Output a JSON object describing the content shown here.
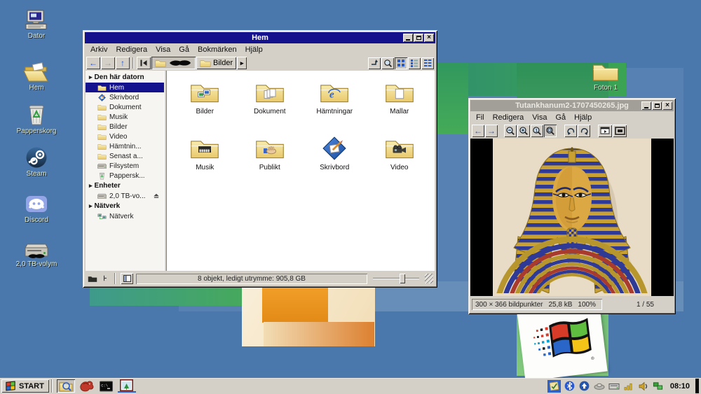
{
  "desktop": {
    "icons": [
      {
        "label": "Dator"
      },
      {
        "label": "Hem"
      },
      {
        "label": "Papperskorg"
      },
      {
        "label": "Steam"
      },
      {
        "label": "Discord"
      },
      {
        "label": "2,0 TB-volym"
      },
      {
        "label": "Foton 1"
      }
    ]
  },
  "file_manager": {
    "title": "Hem",
    "menus": [
      "Arkiv",
      "Redigera",
      "Visa",
      "Gå",
      "Bokmärken",
      "Hjälp"
    ],
    "toolbar": {
      "current_folder": "Bilder"
    },
    "sidebar": {
      "section1": "Den här datorn",
      "items1": [
        "Hem",
        "Skrivbord",
        "Dokument",
        "Musik",
        "Bilder",
        "Video",
        "Hämtnin...",
        "Senast a...",
        "Filsystem",
        "Pappersk..."
      ],
      "section2": "Enheter",
      "items2": [
        "2,0 TB-vo..."
      ],
      "section3": "Nätverk",
      "items3": [
        "Nätverk"
      ]
    },
    "files": [
      "Bilder",
      "Dokument",
      "Hämtningar",
      "Mallar",
      "Musik",
      "Publikt",
      "Skrivbord",
      "Video"
    ],
    "status": "8 objekt, ledigt utrymme: 905,8 GB"
  },
  "image_viewer": {
    "title": "Tutankhanum2-1707450265.jpg",
    "menus": [
      "Fil",
      "Redigera",
      "Visa",
      "Gå",
      "Hjälp"
    ],
    "status": {
      "dimensions": "300 × 366 bildpunkter",
      "filesize": "25,8 kB",
      "zoom": "100%",
      "position": "1 / 55"
    }
  },
  "taskbar": {
    "start": "START",
    "clock": "08:10"
  },
  "colors": {
    "desktop": "#4a78ad",
    "active_title": "#14128c",
    "inactive_title": "#a29f98",
    "chrome": "#d4d0c8",
    "selection": "#14128c"
  }
}
